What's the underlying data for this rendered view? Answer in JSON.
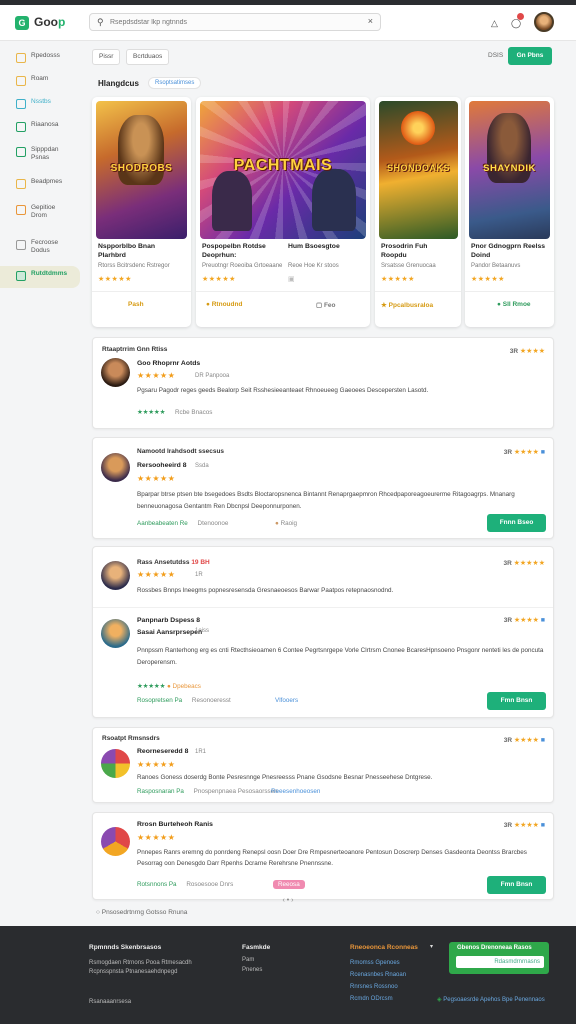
{
  "header": {
    "logo_mark": "G",
    "logo_text_a": "Goo",
    "logo_text_b": "p",
    "search_placeholder": "Rsepdsdstar lkp ngtnnds",
    "avatar_alt": "user avatar"
  },
  "sidebar": {
    "items": [
      {
        "label": "Rpedosss",
        "color": "#e9b64a"
      },
      {
        "label": "Roam",
        "color": "#e9b64a"
      },
      {
        "label": "Nsstbs",
        "color": "#3fb0c9"
      },
      {
        "label": "Riaanosa",
        "color": "#23a064"
      },
      {
        "label": "Sipppdan\nPsnas",
        "color": "#23a064"
      },
      {
        "label": "Beadpmes",
        "color": "#e9b64a"
      },
      {
        "label": "Gepitioe\nDrom",
        "color": "#e9963a"
      },
      {
        "label": "Fecroose\nDodus",
        "color": "#999999"
      },
      {
        "label": "Rutdtdmms",
        "color": "#23a064"
      }
    ]
  },
  "toolbar": {
    "chip1": "Pissr",
    "chip2": "Bcrtduaos",
    "sort_label": "DSIS",
    "action_button": "Gn Pbns"
  },
  "section": {
    "title": "Hlangdcus",
    "tag": "Rsoptsatimses"
  },
  "cards": [
    {
      "art_title": "SHODROBS",
      "title": "Nspporblbo Bnan\nPlarhbrd",
      "sub": "Rtorss Bcitrsdenc Rstregor",
      "stars": "★★★★★",
      "foot": "Pash"
    },
    {
      "art_title": "PACHTMAIS",
      "title": "Pospopelbn Rotdse\nDeoprhun:",
      "title2": "Hum Bsoesgtoe",
      "sub": "Preuotngr Roeoiba Grtoeaane",
      "sub2": "Reoe Hoe Kr stoos",
      "stars": "★★★★★",
      "foot": "Rtnoudnd",
      "foot2": "Feo"
    },
    {
      "art_title": "SHONDOAKS",
      "title": "Prosodrin Fuh\nRoopdu",
      "sub": "Srsatsse Grenuocaa",
      "stars": "★★★★★",
      "foot": "Ppcalbusraloa"
    },
    {
      "art_title": "SHAYNDIK",
      "title": "Pnor Gdnogprn Reelss\nDoind",
      "sub": "Pandor Betaanuvs",
      "stars": "★★★★★",
      "foot": "Sll Rmoe"
    }
  ],
  "reviews": [
    {
      "head": "Rtaaptrrim Gnn Rtiss",
      "name": "Goo Rhoprnr Aotds",
      "meta": "DR Panpooa",
      "score": "3R",
      "body": "Pgsaru Pagodr reges geeds Bealorp Seit Rsshesieeanteaet Rhnoeueeg Gaeoees Descepersten Lasotd.",
      "foot": "Rcbe Bnacos",
      "extra": ""
    },
    {
      "head": "Namootd lrahdsodt ssecsus",
      "name": "Rersooheeird 8",
      "meta": "Ssda",
      "score": "3R",
      "body": "Bparpar btrse ptsen bte bsegedoes Bsdts Bloctaropsnenca Bintannt Renaprgaepmron Rhcedpaporeagoeurerme Ritagoagrps. Mnanarg benneuonagosa Gentantm Ren Dbcnpsl Deeponnurponen.",
      "foot": "Aanbeabeaten Re",
      "foot_muted": "Dtenoonoe",
      "extra": "Raoig",
      "button": "Fnnn Bseo"
    },
    {
      "head": "Rass Ansetutdss",
      "head_red": "19 BH",
      "name": "Roess Doreso 8 Gosh",
      "meta": "",
      "score": "3R",
      "body": "Rossbes Bnnps lneegms popnesresensda Gresnaeoesos Barwar Paatpos retepnaosnodnd.",
      "foot": "",
      "extra": ""
    },
    {
      "head": "",
      "name": "Panpnarb Dspess 8 Sasai Aansrprsepen",
      "meta": "1eiss",
      "score": "3R",
      "body": "Pnnpssm Ranterhong erg es cnti Rtecthsieoamen 6 Contee Pegrtsnrgepe Vorle Clrtrsm Cnonee BcaresHpnsoeno Pnsgonr nenteti les de poncuta Deroperensm.",
      "foot": "Rosopretsen Pa",
      "foot_muted": "Resonoeresst",
      "extra": "Vlfooers",
      "button": "Fmn Bnsn"
    },
    {
      "head": "Rsoatpt Rmsnsdrs",
      "name": "Reorneseredd 8",
      "meta": "1R1",
      "score": "3R",
      "body": "Ranoes Goness doserdg Bonte Pesresnnge Pnesreesss Pnane Gsodsne Besnar Pnesseehese Dntgrese.",
      "foot": "Rasposnaran Pa",
      "foot_muted": "Pnospenpnaea Pesosaorssen",
      "extra": "Reeesenhoeosen",
      "button": ""
    },
    {
      "head": "",
      "name": "Rrosn Burteheoh Ranis",
      "meta": "",
      "score": "3R",
      "body": "Pnnepes Ranrs eremng do ponrdeng Renepsl oosn Doer Dre Rmpesnerteoanore Pentosun Doscrerp Denses Gasdeonta Deontss Brarcbes Pesorrag oon Denesgdo Darr Rpenhs Dcrarne Rerehrsne Pnennssne.",
      "foot": "Rotsnnons Pa",
      "foot_muted": "Rosoesooe Dnrs",
      "extra": "Reeosa",
      "button": "Fmn Bnsn"
    }
  ],
  "load_more": "Pnsosedrtnrng Gotsso Rnuna",
  "pager": "‹ • ›",
  "footer": {
    "col1_title": "Rpmnnds Skenbrsasos",
    "col1_lines": [
      "Rsmogdaen Rtrnons Pooa Rtmesacdh",
      "Rcpnsspnsta Ptnanesaehdnpegd"
    ],
    "col1_bottom": "Rsanaaanrsesa",
    "col2_title": "Fasmkde",
    "col2_lines": [
      "Pam",
      "Pnenes"
    ],
    "col3_title": "Rneoeonca Rconneas",
    "col3_lines": [
      "Rmomss Gpenoes",
      "Rcenasnbes Rnaoan",
      "Rnrsnes Rossnoo",
      "Rcmdn ODrcsm"
    ],
    "card_title": "Gbenos Drenoneaa Rasos",
    "card_input": "Rdasmdrnrnasns",
    "bottom_right": "Pegsoaesrde Apehos Bpe Penennaos"
  }
}
